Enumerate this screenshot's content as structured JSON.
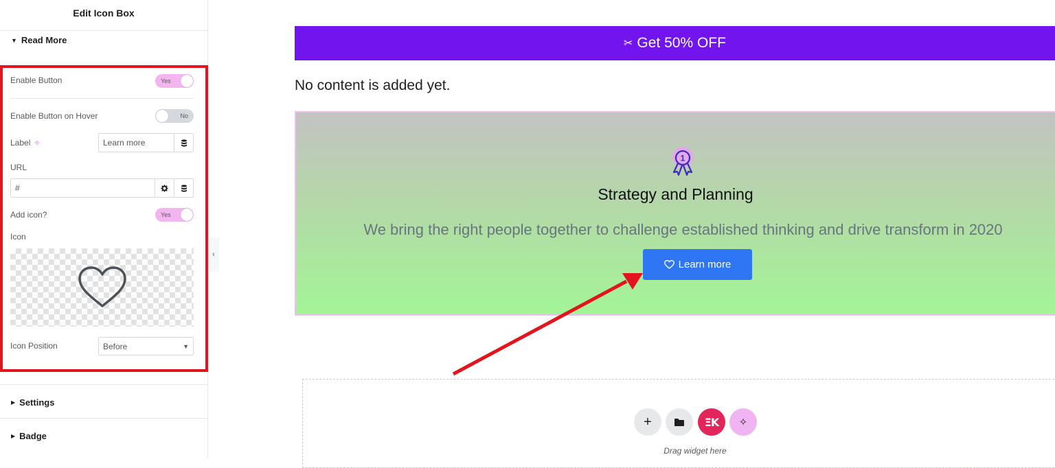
{
  "panel": {
    "title": "Edit Icon Box",
    "sections": {
      "read_more": "Read More",
      "settings": "Settings",
      "badge": "Badge"
    },
    "fields": {
      "enable_button": {
        "label": "Enable Button",
        "value": "Yes"
      },
      "enable_button_hover": {
        "label": "Enable Button on Hover",
        "value": "No"
      },
      "label": {
        "label": "Label",
        "value": "Learn more"
      },
      "url": {
        "label": "URL",
        "value": "#"
      },
      "add_icon": {
        "label": "Add icon?",
        "value": "Yes"
      },
      "icon": {
        "label": "Icon",
        "preview_icon": "heart-outline-icon"
      },
      "icon_position": {
        "label": "Icon Position",
        "value": "Before"
      }
    }
  },
  "canvas": {
    "promo_bar": {
      "icon": "scissors-icon",
      "text": "Get 50% OFF",
      "color": "#7114ee"
    },
    "no_content": "No content is added yet.",
    "icon_box": {
      "icon": "award-ribbon-icon",
      "title": "Strategy and Planning",
      "description": "We bring the right people together to challenge established thinking and drive transform in 2020",
      "button": {
        "icon": "heart-icon",
        "label": "Learn more",
        "color": "#2f76f5"
      }
    },
    "drop_zone": {
      "label": "Drag widget here",
      "buttons": [
        "add-icon",
        "folder-icon",
        "elementskit-icon",
        "ai-sparkle-icon"
      ]
    }
  },
  "colors": {
    "accent_pink": "#f3b5ef",
    "highlight_red": "#e3141b",
    "brand_red": "#e2265b"
  }
}
